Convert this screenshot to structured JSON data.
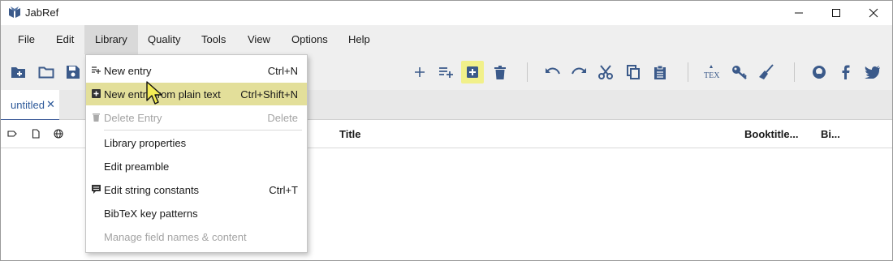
{
  "window": {
    "title": "JabRef"
  },
  "menubar": {
    "items": [
      "File",
      "Edit",
      "Library",
      "Quality",
      "Tools",
      "View",
      "Options",
      "Help"
    ],
    "active": "Library"
  },
  "toolbar": {
    "icons": [
      "new-library-icon",
      "open-folder-icon",
      "save-icon",
      "add-icon",
      "add-list-icon",
      "new-entry-icon",
      "delete-icon",
      "undo-icon",
      "redo-icon",
      "cut-icon",
      "copy-icon",
      "paste-icon",
      "tex-icon",
      "key-icon",
      "broom-icon",
      "github-icon",
      "facebook-icon",
      "twitter-icon"
    ],
    "highlight_color": "#f1f08a"
  },
  "tabs": [
    {
      "label": "untitled",
      "close": "✕"
    }
  ],
  "table": {
    "columns": [
      "Title",
      "Booktitle...",
      "Bi..."
    ]
  },
  "library_menu": {
    "items": [
      {
        "label": "New entry",
        "shortcut": "Ctrl+N",
        "icon": "new-entry-icon",
        "enabled": true
      },
      {
        "label": "New entry from plain text",
        "shortcut": "Ctrl+Shift+N",
        "icon": "plain-text-entry-icon",
        "enabled": true,
        "hovered": true
      },
      {
        "label": "Delete Entry",
        "shortcut": "Delete",
        "icon": "trash-icon",
        "enabled": false
      },
      {
        "label": "Library properties",
        "shortcut": "",
        "enabled": true
      },
      {
        "label": "Edit preamble",
        "shortcut": "",
        "enabled": true
      },
      {
        "label": "Edit string constants",
        "shortcut": "Ctrl+T",
        "icon": "string-constants-icon",
        "enabled": true
      },
      {
        "label": "BibTeX key patterns",
        "shortcut": "",
        "enabled": true
      },
      {
        "label": "Manage field names & content",
        "shortcut": "",
        "enabled": false
      }
    ],
    "hover_color": "#e3df9a"
  }
}
